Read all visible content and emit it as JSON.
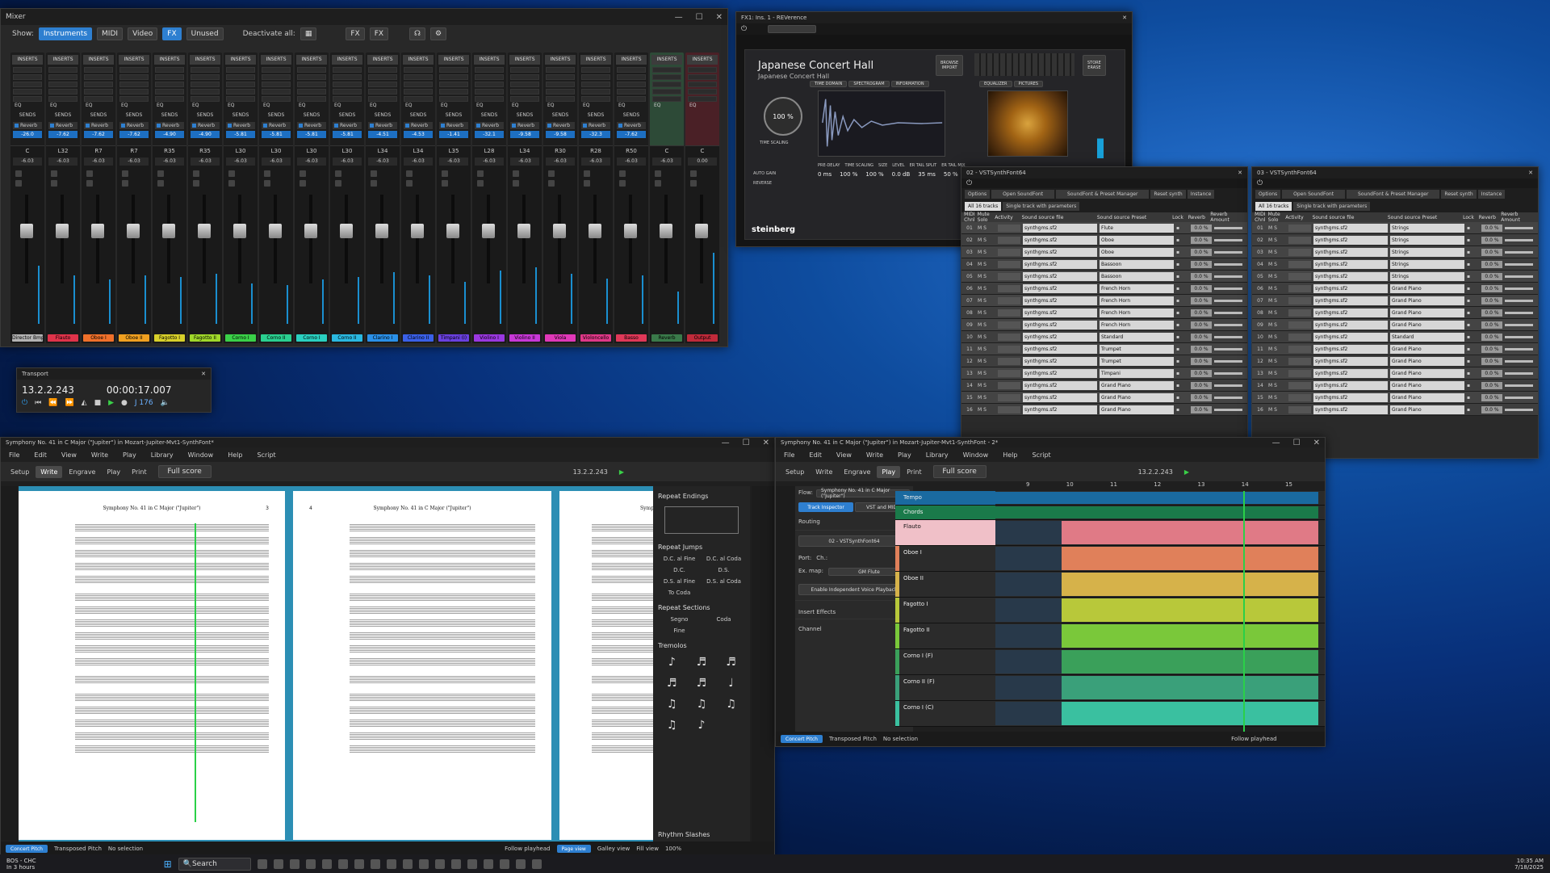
{
  "mixer": {
    "title": "Mixer",
    "show_label": "Show:",
    "filters": [
      "Instruments",
      "MIDI",
      "Video",
      "FX",
      "Unused"
    ],
    "deactivate": "Deactivate all:",
    "strips": [
      {
        "pan": "C",
        "vol": "-6.03",
        "send": "-26.0",
        "name": "Director Bmp 1",
        "color": "#b3b3b3"
      },
      {
        "pan": "L32",
        "vol": "-6.03",
        "send": "-7.62",
        "name": "Flauto",
        "color": "#e0334a"
      },
      {
        "pan": "R7",
        "vol": "-6.03",
        "send": "-7.62",
        "name": "Oboe I",
        "color": "#f0702a"
      },
      {
        "pan": "R7",
        "vol": "-6.03",
        "send": "-7.62",
        "name": "Oboe II",
        "color": "#f0a020"
      },
      {
        "pan": "R35",
        "vol": "-6.03",
        "send": "-4.90",
        "name": "Fagotto I",
        "color": "#d8d02a"
      },
      {
        "pan": "R35",
        "vol": "-6.03",
        "send": "-4.90",
        "name": "Fagotto II",
        "color": "#a0d82a"
      },
      {
        "pan": "L30",
        "vol": "-6.03",
        "send": "-5.81",
        "name": "Corno I",
        "color": "#3ad048"
      },
      {
        "pan": "L30",
        "vol": "-6.03",
        "send": "-5.81",
        "name": "Corno II",
        "color": "#2ad090"
      },
      {
        "pan": "L30",
        "vol": "-6.03",
        "send": "-5.81",
        "name": "Corno I",
        "color": "#2ad0c0"
      },
      {
        "pan": "L30",
        "vol": "-6.03",
        "send": "-5.81",
        "name": "Corno II",
        "color": "#2ab8e0"
      },
      {
        "pan": "L34",
        "vol": "-6.03",
        "send": "-4.51",
        "name": "Clarino I",
        "color": "#2a90e8"
      },
      {
        "pan": "L34",
        "vol": "-6.03",
        "send": "-4.53",
        "name": "Clarino II",
        "color": "#3a60e8"
      },
      {
        "pan": "L35",
        "vol": "-6.03",
        "send": "-1.41",
        "name": "Timpani (I)",
        "color": "#6a40e0"
      },
      {
        "pan": "L28",
        "vol": "-6.03",
        "send": "-32.1",
        "name": "Violino I",
        "color": "#9a38e0"
      },
      {
        "pan": "L34",
        "vol": "-6.03",
        "send": "-9.58",
        "name": "Violino II",
        "color": "#c838d8"
      },
      {
        "pan": "R30",
        "vol": "-6.03",
        "send": "-9.58",
        "name": "Viola",
        "color": "#e038b8"
      },
      {
        "pan": "R28",
        "vol": "-6.03",
        "send": "-32.3",
        "name": "Violoncello",
        "color": "#e03888"
      },
      {
        "pan": "R50",
        "vol": "-6.03",
        "send": "-7.62",
        "name": "Basso",
        "color": "#e03858"
      },
      {
        "pan": "C",
        "vol": "-6.03",
        "send": "",
        "name": "Reverb",
        "color": "#3a7a4a"
      },
      {
        "pan": "C",
        "vol": "0.00",
        "send": "",
        "name": "Output",
        "color": "#c02a3a"
      }
    ],
    "insert_label": "INSERTS",
    "sends_label": "SENDS",
    "eq_label": "EQ",
    "reverb_label": "Reverb"
  },
  "transport": {
    "title": "Transport",
    "bars": "13.2.2.243",
    "time": "00:00:17.007",
    "tempo": "J 176"
  },
  "reverence": {
    "title": "FX1: Ins. 1 - REVerence",
    "preset": "Japanese Concert Hall",
    "sub": "Japanese Concert Hall",
    "browse": "BROWSE",
    "import": "IMPORT",
    "store": "STORE",
    "erase": "ERASE",
    "mix": "100 %",
    "mix_label": "TIME SCALING",
    "tabs": [
      "TIME DOMAIN",
      "SPECTROGRAM",
      "INFORMATION"
    ],
    "tabs2": [
      "EQUALIZER",
      "PICTURES"
    ],
    "params": [
      "PRE-DELAY",
      "TIME SCALING",
      "SIZE",
      "LEVEL",
      "ER TAIL SPLIT",
      "ER TAIL MIX"
    ],
    "values": [
      "0 ms",
      "100 %",
      "100 %",
      "0.0 dB",
      "35 ms",
      "50 %"
    ],
    "autogain": "AUTO GAIN",
    "reverse": "REVERSE",
    "brand": "steinberg"
  },
  "synth1": {
    "title": "02 - VSTSynthFont64",
    "options": "Options",
    "open": "Open SoundFont",
    "mgr": "SoundFont & Preset Manager",
    "reset": "Reset synth",
    "instance": "Instance",
    "tab1": "All 16 tracks",
    "tab2": "Single track with parameters",
    "cols": [
      "MIDI Chnl",
      "Mute Solo",
      "Activity",
      "Sound source file",
      "Sound source Preset",
      "Lock",
      "Reverb",
      "Reverb Amount"
    ],
    "rows": [
      [
        "01",
        "Flute"
      ],
      [
        "02",
        "Oboe"
      ],
      [
        "03",
        "Oboe"
      ],
      [
        "04",
        "Bassoon"
      ],
      [
        "05",
        "Bassoon"
      ],
      [
        "06",
        "French Horn"
      ],
      [
        "07",
        "French Horn"
      ],
      [
        "08",
        "French Horn"
      ],
      [
        "09",
        "French Horn"
      ],
      [
        "10",
        "Standard"
      ],
      [
        "11",
        "Trumpet"
      ],
      [
        "12",
        "Trumpet"
      ],
      [
        "13",
        "Timpani"
      ],
      [
        "14",
        "Grand Piano"
      ],
      [
        "15",
        "Grand Piano"
      ],
      [
        "16",
        "Grand Piano"
      ]
    ],
    "file": "synthgms.sf2",
    "rev": "0.0 %"
  },
  "synth2": {
    "title": "03 - VSTSynthFont64",
    "rows": [
      [
        "01",
        "Strings"
      ],
      [
        "02",
        "Strings"
      ],
      [
        "03",
        "Strings"
      ],
      [
        "04",
        "Strings"
      ],
      [
        "05",
        "Strings"
      ],
      [
        "06",
        "Grand Piano"
      ],
      [
        "07",
        "Grand Piano"
      ],
      [
        "08",
        "Grand Piano"
      ],
      [
        "09",
        "Grand Piano"
      ],
      [
        "10",
        "Standard"
      ],
      [
        "11",
        "Grand Piano"
      ],
      [
        "12",
        "Grand Piano"
      ],
      [
        "13",
        "Grand Piano"
      ],
      [
        "14",
        "Grand Piano"
      ],
      [
        "15",
        "Grand Piano"
      ],
      [
        "16",
        "Grand Piano"
      ]
    ]
  },
  "dorico_left": {
    "title": "Symphony No. 41 in C Major (\"Jupiter\") in Mozart-Jupiter-Mvt1-SynthFont*",
    "menus": [
      "File",
      "Edit",
      "View",
      "Write",
      "Play",
      "Library",
      "Window",
      "Help",
      "Script"
    ],
    "modes": [
      "Setup",
      "Write",
      "Engrave",
      "Play",
      "Print"
    ],
    "layout": "Full score",
    "pos": "13.2.2.243",
    "page_title": "Symphony No. 41 in C Major (\"Jupiter\")",
    "page_num_l": "3",
    "page_num_r": "4",
    "panel": {
      "endings": "Repeat Endings",
      "jumps": "Repeat Jumps",
      "jump_items": [
        "D.C. al Fine",
        "D.C. al Coda",
        "D.C.",
        "D.S.",
        "D.S. al Fine",
        "D.S. al Coda",
        "To Coda"
      ],
      "sections": "Repeat Sections",
      "section_items": [
        "Segno",
        "Coda",
        "Fine"
      ],
      "tremolos": "Tremolos",
      "slashes": "Rhythm Slashes"
    },
    "status": [
      "Concert Pitch",
      "Transposed Pitch",
      "No selection",
      "Follow playhead",
      "Page view",
      "Galley view",
      "Fill view",
      "100%"
    ]
  },
  "dorico_right": {
    "title": "Symphony No. 41 in C Major (\"Jupiter\") in Mozart-Jupiter-Mvt1-SynthFont - 2*",
    "flow": "Flow:",
    "flow_name": "Symphony No. 41 in C Major (\"Jupiter\")",
    "tab1": "Track Inspector",
    "tab2": "VST and MIDI",
    "routing": "Routing",
    "device": "02 - VSTSynthFont64",
    "port": "Port:",
    "ch": "Ch.:",
    "exmap": "Ex. map:",
    "exmap_val": "GM Flute",
    "indep": "Enable Independent Voice Playback",
    "insert": "Insert Effects",
    "channel": "Channel",
    "bars": [
      "9",
      "10",
      "11",
      "12",
      "13",
      "14",
      "15"
    ],
    "tracks": [
      {
        "name": "Tempo",
        "color": "#1a6aa0"
      },
      {
        "name": "Chords",
        "color": "#1a7a4a"
      },
      {
        "name": "Flauto",
        "color": "#e07a86"
      },
      {
        "name": "Oboe I",
        "color": "#e0805a"
      },
      {
        "name": "Oboe II",
        "color": "#d6b24a"
      },
      {
        "name": "Fagotto I",
        "color": "#b8c83a"
      },
      {
        "name": "Fagotto II",
        "color": "#7ac83a"
      },
      {
        "name": "Corno I (F)",
        "color": "#3aa05a"
      },
      {
        "name": "Corno II (F)",
        "color": "#3aa07a"
      },
      {
        "name": "Corno I (C)",
        "color": "#3ac0a0"
      }
    ],
    "status": [
      "Concert Pitch",
      "Transposed Pitch",
      "No selection",
      "Follow playhead"
    ]
  },
  "taskbar": {
    "weather": "BOS - CHC",
    "weather2": "In 3 hours",
    "search": "Search",
    "time": "10:35 AM",
    "date": "7/18/2025"
  }
}
